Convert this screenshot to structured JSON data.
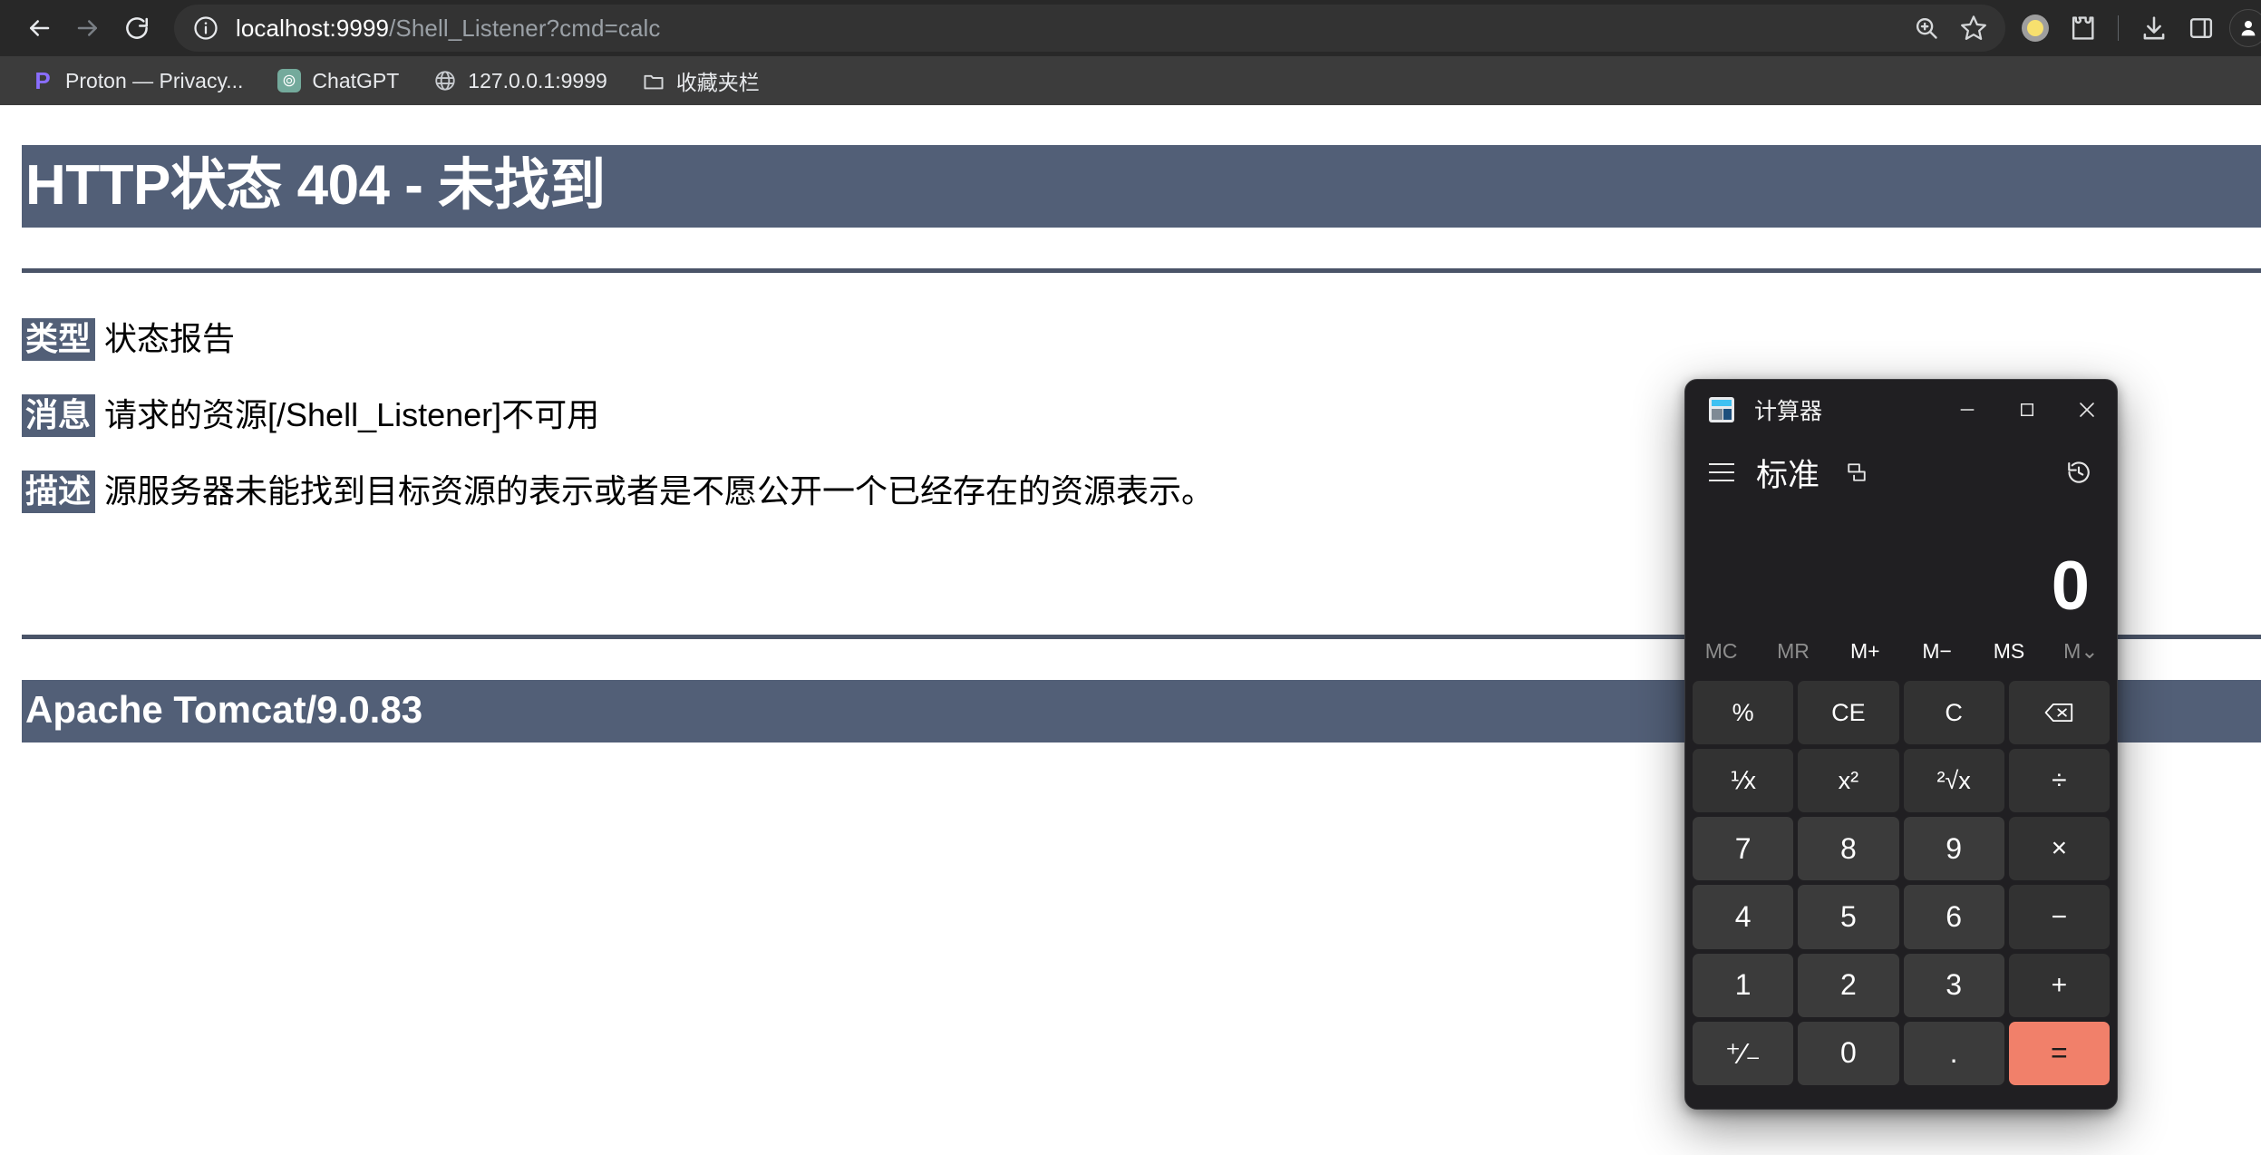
{
  "browser": {
    "nav": {
      "back": "back-arrow",
      "forward": "forward-arrow",
      "reload": "reload"
    },
    "omnibox": {
      "site_info_icon": "info-circle",
      "url_host": "localhost:9999",
      "url_path": "/Shell_Listener?cmd=calc",
      "url_full": "localhost:9999/Shell_Listener?cmd=calc",
      "zoom_icon": "zoom-in-magnifier",
      "bookmark_icon": "star-outline"
    },
    "toolbar_right": {
      "profile_badge": "yellow-dot",
      "extensions": "puzzle-piece",
      "downloads": "download-arrow",
      "side_panel": "side-panel",
      "account": "person-avatar"
    },
    "bookmarks": [
      {
        "label": "Proton — Privacy...",
        "icon": "proton-logo"
      },
      {
        "label": "ChatGPT",
        "icon": "chatgpt-logo"
      },
      {
        "label": "127.0.0.1:9999",
        "icon": "globe-icon"
      },
      {
        "label": "收藏夹栏",
        "icon": "folder-icon"
      }
    ]
  },
  "tomcat": {
    "heading": "HTTP状态 404 - 未找到",
    "rows": [
      {
        "label": "类型",
        "value": "状态报告"
      },
      {
        "label": "消息",
        "value": "请求的资源[/Shell_Listener]不可用"
      },
      {
        "label": "描述",
        "value": "源服务器未能找到目标资源的表示或者是不愿公开一个已经存在的资源表示。"
      }
    ],
    "footer": "Apache Tomcat/9.0.83",
    "accent_color": "#525F77"
  },
  "calculator": {
    "window_title": "计算器",
    "app_icon": "calculator-icon",
    "window_controls": {
      "minimize": "minimize-icon",
      "maximize": "maximize-icon",
      "close": "close-icon"
    },
    "menu_icon": "hamburger-menu-icon",
    "mode": "标准",
    "keep_on_top_icon": "keep-on-top-icon",
    "history_icon": "history-clock-icon",
    "display_value": "0",
    "memory": [
      {
        "label": "MC",
        "enabled": false
      },
      {
        "label": "MR",
        "enabled": false
      },
      {
        "label": "M+",
        "enabled": true
      },
      {
        "label": "M−",
        "enabled": true
      },
      {
        "label": "MS",
        "enabled": true
      },
      {
        "label": "M⌄",
        "enabled": false
      }
    ],
    "keys": [
      {
        "label": "%",
        "kind": "fn",
        "name": "percent"
      },
      {
        "label": "CE",
        "kind": "fn",
        "name": "clear-entry"
      },
      {
        "label": "C",
        "kind": "fn",
        "name": "clear"
      },
      {
        "label": "⌫",
        "kind": "fn",
        "name": "backspace"
      },
      {
        "label": "⅟x",
        "kind": "fn",
        "name": "reciprocal"
      },
      {
        "label": "x²",
        "kind": "fn",
        "name": "square"
      },
      {
        "label": "²√x",
        "kind": "fn",
        "name": "square-root"
      },
      {
        "label": "÷",
        "kind": "op",
        "name": "divide"
      },
      {
        "label": "7",
        "kind": "num",
        "name": "seven"
      },
      {
        "label": "8",
        "kind": "num",
        "name": "eight"
      },
      {
        "label": "9",
        "kind": "num",
        "name": "nine"
      },
      {
        "label": "×",
        "kind": "op",
        "name": "multiply"
      },
      {
        "label": "4",
        "kind": "num",
        "name": "four"
      },
      {
        "label": "5",
        "kind": "num",
        "name": "five"
      },
      {
        "label": "6",
        "kind": "num",
        "name": "six"
      },
      {
        "label": "−",
        "kind": "op",
        "name": "subtract"
      },
      {
        "label": "1",
        "kind": "num",
        "name": "one"
      },
      {
        "label": "2",
        "kind": "num",
        "name": "two"
      },
      {
        "label": "3",
        "kind": "num",
        "name": "three"
      },
      {
        "label": "+",
        "kind": "op",
        "name": "add"
      },
      {
        "label": "⁺∕₋",
        "kind": "num",
        "name": "negate"
      },
      {
        "label": "0",
        "kind": "num",
        "name": "zero"
      },
      {
        "label": ".",
        "kind": "num",
        "name": "decimal"
      },
      {
        "label": "=",
        "kind": "equals",
        "name": "equals"
      }
    ],
    "equals_color": "#F1806A"
  }
}
